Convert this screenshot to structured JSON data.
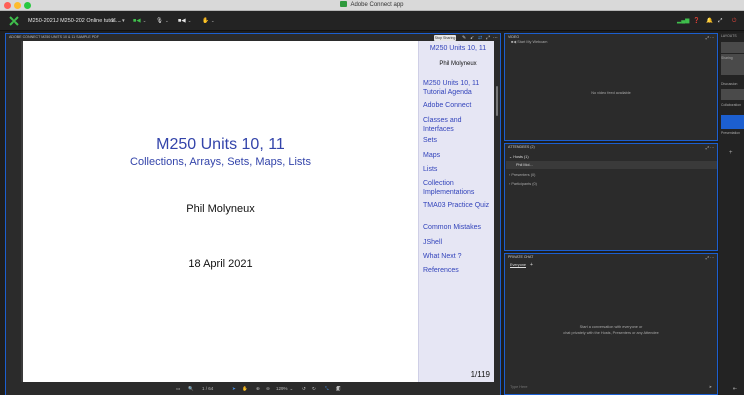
{
  "window": {
    "title": "Adobe Connect app"
  },
  "toolbar": {
    "meeting_name": "M250-2021J M250-202 Online tutor...",
    "status_icons": [
      "grid-icon",
      "green-cam-icon",
      "mic-icon",
      "camera-icon",
      "hand-icon"
    ]
  },
  "share_pod": {
    "header": "ADOBE CONNECT M250 UNITS 10 & 11 SAMPLE PDF",
    "sharing_button": "Stop Sharing",
    "slide": {
      "title": "M250 Units 10, 11",
      "subtitle": "Collections, Arrays, Sets, Maps, Lists",
      "author": "Phil Molyneux",
      "date": "18 April 2021",
      "page": "1/119"
    },
    "sidebar": [
      "M250 Units 10, 11",
      "Phil Molyneux",
      "M250 Units 10, 11 Tutorial Agenda",
      "Adobe Connect",
      "Classes and Interfaces",
      "Sets",
      "Maps",
      "Lists",
      "Collection Implementations",
      "TMA03 Practice Quiz",
      "Common Mistakes",
      "JShell",
      "What Next ?",
      "References"
    ],
    "bottombar": {
      "page_indicator": "1 / 64",
      "zoom": "129%"
    }
  },
  "video_pod": {
    "header": "VIDEO",
    "start_label": "Start My Webcam",
    "empty_text": "No video feed available"
  },
  "attendees_pod": {
    "header": "ATTENDEES (2)",
    "groups": [
      {
        "label": "Hosts (1)",
        "members": [
          "Phil Mol..."
        ]
      },
      {
        "label": "Presenters (0)",
        "members": []
      },
      {
        "label": "Participants (0)",
        "members": []
      }
    ]
  },
  "chat_pod": {
    "header": "PRIVATE CHAT",
    "tab": "Everyone",
    "add_tab": "+",
    "empty_line1": "Start a conversation with everyone or",
    "empty_line2": "chat privately with the Hosts, Presenters or any Attendee",
    "input_placeholder": "Type Here"
  },
  "right_strip": {
    "header": "LAYOUTS",
    "sections": [
      "Sharing",
      "Discussion",
      "Collaboration",
      "Presentation"
    ],
    "add": "+"
  },
  "colors": {
    "accent": "#1c5fd0",
    "slide_title": "#3344aa",
    "sidebar_bg": "#e6e6f4"
  }
}
